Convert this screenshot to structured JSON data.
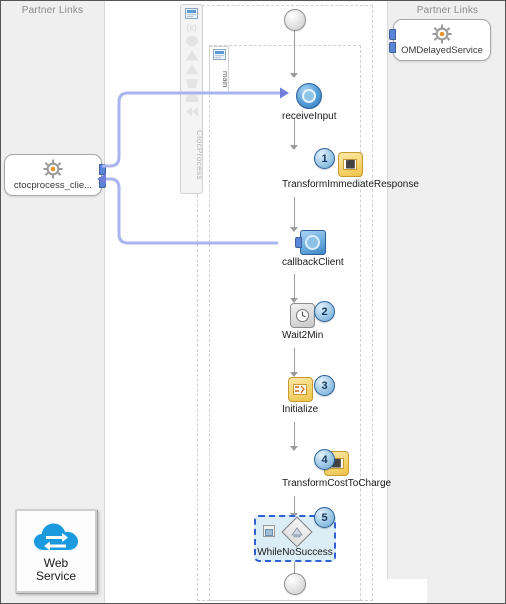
{
  "panels": {
    "left": {
      "title": "Partner Links"
    },
    "right": {
      "title": "Partner Links"
    }
  },
  "partner_links": [
    {
      "name": "ctocprocess_client",
      "label": "ctocprocess_clie...",
      "icon": "gear-icon",
      "side": "left"
    },
    {
      "name": "OMDelayedService",
      "label": "OMDelayedService",
      "icon": "gear-icon",
      "side": "right"
    }
  ],
  "scope": {
    "strip_label": "CtocProcess",
    "main_label": "main",
    "palette_icons": [
      "scope-icon",
      "variables-icon",
      "circle-shape-icon",
      "triangle-up-icon",
      "triangle-up-icon-2",
      "trapezoid-icon",
      "pentagon-icon",
      "rewind-icon"
    ]
  },
  "flow": {
    "start_node": "process-start",
    "end_node": "process-end",
    "activities": [
      {
        "name": "receiveInput",
        "label": "receiveInput",
        "type": "receive",
        "badge": null,
        "icon": "receive-activity-icon"
      },
      {
        "name": "TransformImmediateResponse",
        "label": "TransformImmediateResponse",
        "type": "transform",
        "badge": "1",
        "icon": "transform-activity-icon"
      },
      {
        "name": "callbackClient",
        "label": "callbackClient",
        "type": "invoke",
        "badge": null,
        "icon": "invoke-activity-icon"
      },
      {
        "name": "Wait2Min",
        "label": "Wait2Min",
        "type": "wait",
        "badge": "2",
        "icon": "wait-clock-icon"
      },
      {
        "name": "Initialize",
        "label": "Initialize",
        "type": "assign",
        "badge": "3",
        "icon": "assign-activity-icon"
      },
      {
        "name": "TransformCostToCharge",
        "label": "TransformCostToCharge",
        "type": "transform",
        "badge": "4",
        "icon": "transform-activity-icon"
      },
      {
        "name": "WhileNoSuccess",
        "label": "WhileNoSuccess",
        "type": "while",
        "badge": "5",
        "icon": "while-loop-icon",
        "selected": true
      }
    ]
  },
  "palette": {
    "web_service": {
      "line1": "Web",
      "line2": "Service",
      "icon": "cloud-exchange-icon"
    }
  },
  "colors": {
    "panel_bg": "#efefef",
    "canvas_bg": "#ffffff",
    "link_blue": "#aab4ee",
    "selection_blue": "#2f5fd0",
    "badge_blue": "#6aa7d4",
    "transform_gold": "#f6d572",
    "activity_blue": "#5ba3da",
    "web_service_blue": "#2196e0"
  }
}
